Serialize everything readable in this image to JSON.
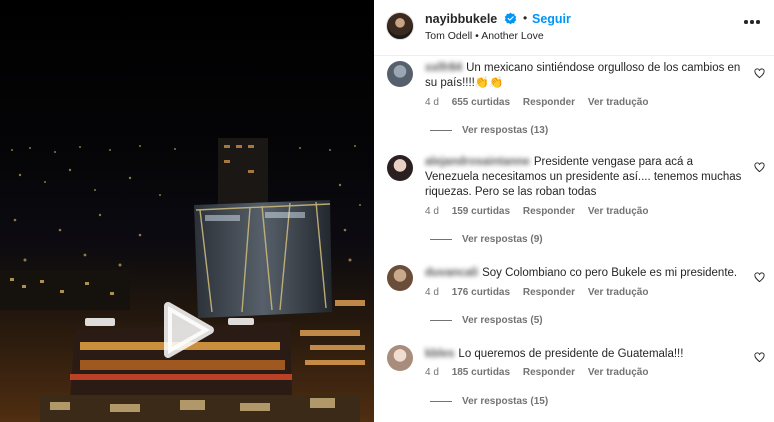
{
  "post": {
    "username": "nayibbukele",
    "follow_label": "Seguir",
    "separator": "•",
    "song": "Tom Odell • Another Love"
  },
  "comments": [
    {
      "user": "xxlfr84",
      "text": "Un mexicano sintiéndose orgulloso de los cambios en su país!!!!👏👏",
      "time": "4 d",
      "likes": "655 curtidas",
      "reply": "Responder",
      "translate": "Ver tradução",
      "view_replies": "Ver respostas (13)"
    },
    {
      "user": "alejandrosaintanne",
      "text": "Presidente vengase para acá a Venezuela necesitamos un presidente así.... tenemos muchas riquezas. Pero se las roban todas",
      "time": "4 d",
      "likes": "159 curtidas",
      "reply": "Responder",
      "translate": "Ver tradução",
      "view_replies": "Ver respostas (9)"
    },
    {
      "user": "duvancali",
      "text": "Soy Colombiano co pero Bukele es mi presidente.",
      "time": "4 d",
      "likes": "176 curtidas",
      "reply": "Responder",
      "translate": "Ver tradução",
      "view_replies": "Ver respostas (5)"
    },
    {
      "user": "kbles",
      "text": "Lo queremos de presidente de Guatemala!!!",
      "time": "4 d",
      "likes": "185 curtidas",
      "reply": "Responder",
      "translate": "Ver tradução",
      "view_replies": "Ver respostas (15)"
    }
  ],
  "colors": {
    "accent": "#0095f6",
    "text": "#262626",
    "secondary": "#737373"
  },
  "icons": [
    "play-icon",
    "verified-badge-icon",
    "more-options-icon",
    "heart-icon"
  ]
}
